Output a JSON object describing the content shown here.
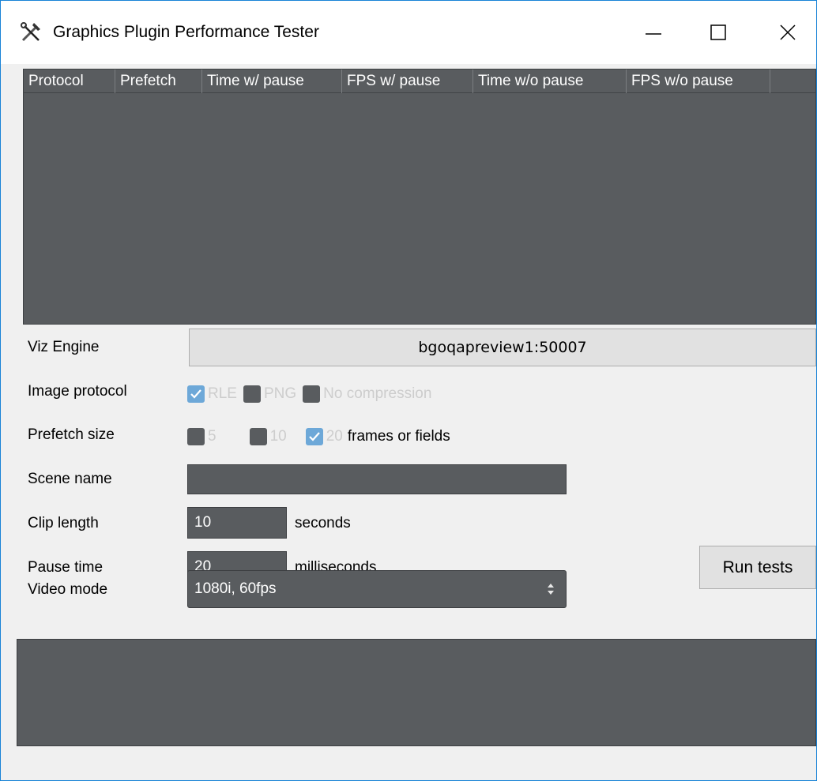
{
  "window": {
    "title": "Graphics Plugin Performance Tester",
    "icon": "tools-icon"
  },
  "window_controls": {
    "minimize_icon": "minimize-icon",
    "maximize_icon": "maximize-icon",
    "close_icon": "close-icon"
  },
  "results_table": {
    "columns": [
      "Protocol",
      "Prefetch",
      "Time w/ pause",
      "FPS w/ pause",
      "Time w/o pause",
      "FPS w/o pause"
    ],
    "rows": []
  },
  "form": {
    "viz_engine": {
      "label": "Viz Engine",
      "value": "bgoqapreview1:50007"
    },
    "image_protocol": {
      "label": "Image protocol",
      "options": [
        {
          "label": "RLE",
          "checked": true
        },
        {
          "label": "PNG",
          "checked": false
        },
        {
          "label": "No compression",
          "checked": false
        }
      ]
    },
    "prefetch_size": {
      "label": "Prefetch size",
      "options": [
        {
          "label": "5",
          "checked": false
        },
        {
          "label": "10",
          "checked": false
        },
        {
          "label": "20",
          "checked": true
        }
      ],
      "suffix": "frames or fields"
    },
    "scene_name": {
      "label": "Scene name",
      "value": ""
    },
    "clip_length": {
      "label": "Clip length",
      "value": "10",
      "unit": "seconds"
    },
    "pause_time": {
      "label": "Pause time",
      "value": "20",
      "unit": "milliseconds"
    },
    "video_mode": {
      "label": "Video mode",
      "value": "1080i, 60fps"
    }
  },
  "actions": {
    "run_tests": "Run tests"
  },
  "colors": {
    "dark_panel": "#595c5f",
    "checked_accent": "#6da8d8",
    "window_border": "#1883d7",
    "button_bg": "#e1e1e1"
  }
}
